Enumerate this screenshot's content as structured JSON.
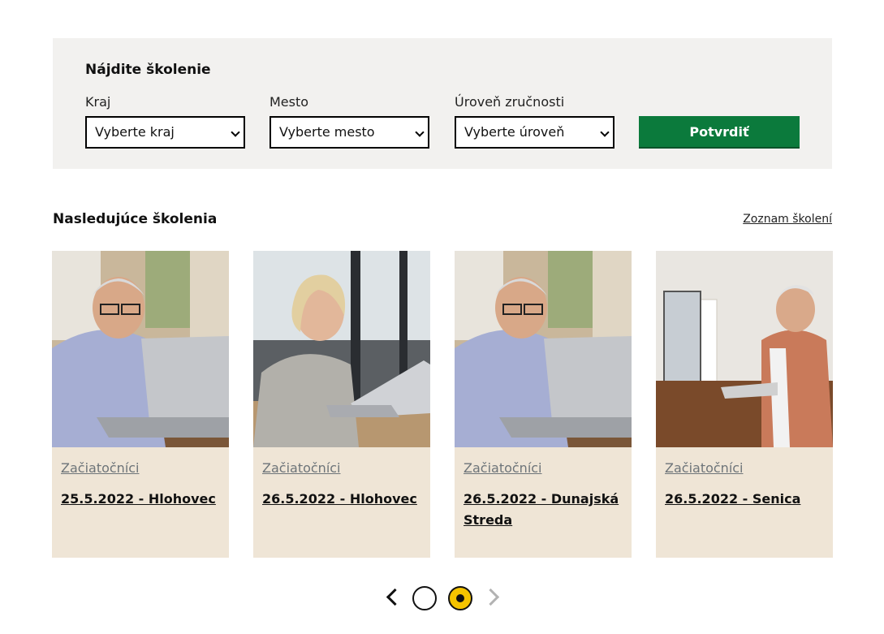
{
  "search": {
    "title": "Nájdite školenie",
    "fields": [
      {
        "label": "Kraj",
        "selected": "Vyberte kraj"
      },
      {
        "label": "Mesto",
        "selected": "Vyberte mesto"
      },
      {
        "label": "Úroveň zručnosti",
        "selected": "Vyberte úroveň"
      }
    ],
    "submit_label": "Potvrdiť"
  },
  "upcoming": {
    "title": "Nasledujúce školenia",
    "list_link": "Zoznam školení",
    "cards": [
      {
        "category": "Začiatočníci",
        "title": "25.5.2022 - Hlohovec"
      },
      {
        "category": "Začiatočníci",
        "title": "26.5.2022 - Hlohovec"
      },
      {
        "category": "Začiatočníci",
        "title": "26.5.2022 - Dunajská Streda"
      },
      {
        "category": "Začiatočníci",
        "title": "26.5.2022 - Senica"
      }
    ]
  },
  "pager": {
    "active_page": 2,
    "page_count": 2
  },
  "colors": {
    "panel_bg": "#f2f1ef",
    "accent_green": "#0b7a3c",
    "card_bg": "#efe5d6",
    "active_dot": "#f5c400"
  }
}
